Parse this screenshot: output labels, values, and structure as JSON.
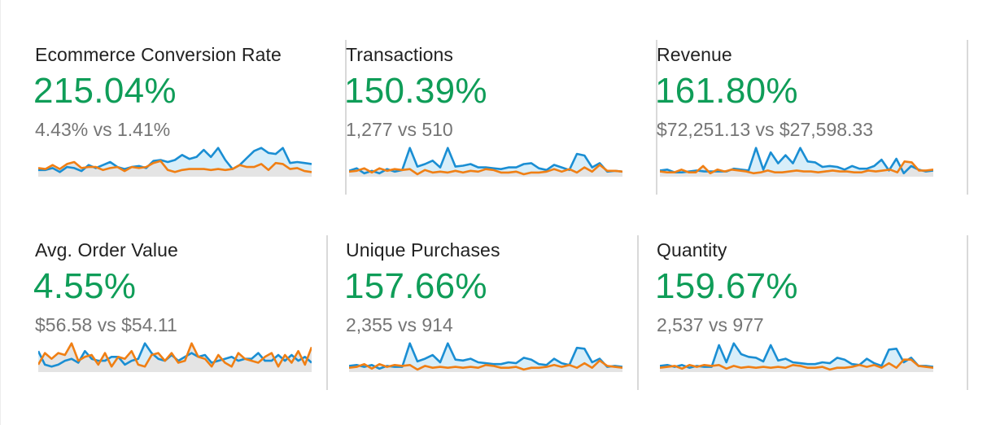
{
  "colors": {
    "percent_text": "#0f9d58",
    "current_series": "#1a8ed3",
    "previous_series": "#f07f14",
    "current_fill": "#d8eef9",
    "previous_fill": "#e4e4e4",
    "divider": "#d9d9d9"
  },
  "metrics": [
    {
      "title": "Ecommerce Conversion Rate",
      "percent_change": "215.04%",
      "comparison": "4.43% vs 1.41%",
      "spark_current": [
        5,
        5,
        7,
        3,
        8,
        7,
        4,
        10,
        7,
        10,
        13,
        8,
        6,
        8,
        9,
        7,
        14,
        15,
        13,
        15,
        20,
        16,
        18,
        25,
        18,
        27,
        15,
        6,
        10,
        17,
        24,
        27,
        22,
        21,
        27,
        12,
        13,
        12,
        11
      ],
      "spark_previous": [
        7,
        6,
        10,
        6,
        11,
        13,
        7,
        8,
        8,
        5,
        7,
        8,
        4,
        8,
        7,
        8,
        12,
        14,
        5,
        3,
        5,
        6,
        6,
        6,
        5,
        6,
        5,
        6,
        10,
        8,
        8,
        11,
        5,
        12,
        11,
        6,
        7,
        4,
        3
      ]
    },
    {
      "title": "Transactions",
      "percent_change": "150.39%",
      "comparison": "1,277 vs 510",
      "spark_current": [
        5,
        8,
        2,
        5,
        2,
        7,
        4,
        6,
        32,
        10,
        13,
        17,
        9,
        32,
        10,
        11,
        13,
        9,
        9,
        8,
        7,
        9,
        9,
        13,
        14,
        8,
        6,
        12,
        9,
        6,
        25,
        23,
        9,
        14,
        4,
        5,
        4
      ],
      "spark_previous": [
        4,
        5,
        8,
        3,
        8,
        5,
        7,
        6,
        7,
        1,
        6,
        3,
        4,
        3,
        5,
        3,
        5,
        4,
        7,
        6,
        3,
        3,
        4,
        1,
        3,
        3,
        4,
        7,
        4,
        7,
        3,
        9,
        4,
        12,
        5,
        5,
        4
      ]
    },
    {
      "title": "Revenue",
      "percent_change": "161.80%",
      "comparison": "$72,251.13 vs $27,598.33",
      "spark_current": [
        5,
        6,
        3,
        3,
        4,
        5,
        4,
        4,
        4,
        4,
        7,
        6,
        5,
        30,
        6,
        25,
        13,
        22,
        13,
        30,
        15,
        14,
        9,
        10,
        9,
        6,
        10,
        7,
        7,
        10,
        17,
        5,
        18,
        2,
        10,
        6,
        4,
        5
      ],
      "spark_previous": [
        4,
        3,
        3,
        6,
        3,
        3,
        10,
        2,
        6,
        4,
        6,
        5,
        4,
        2,
        3,
        5,
        3,
        3,
        4,
        5,
        4,
        4,
        3,
        4,
        5,
        4,
        4,
        3,
        3,
        5,
        4,
        5,
        6,
        3,
        15,
        14,
        5,
        5,
        6
      ]
    },
    {
      "title": "Avg. Order Value",
      "percent_change": "4.55%",
      "comparison": "$56.58 vs $54.11",
      "spark_current": [
        10,
        3,
        2,
        3,
        5,
        6,
        4,
        10,
        6,
        5,
        5,
        7,
        7,
        3,
        5,
        6,
        14,
        9,
        6,
        5,
        8,
        5,
        7,
        9,
        7,
        8,
        4,
        5,
        6,
        7,
        5,
        6,
        6,
        9,
        5,
        5,
        8,
        5,
        8,
        5,
        7,
        4
      ],
      "spark_previous": [
        3,
        9,
        6,
        9,
        8,
        14,
        5,
        7,
        8,
        3,
        9,
        2,
        7,
        6,
        10,
        3,
        2,
        8,
        9,
        5,
        9,
        4,
        5,
        14,
        7,
        6,
        2,
        8,
        4,
        2,
        9,
        6,
        5,
        4,
        7,
        9,
        2,
        8,
        4,
        10,
        3,
        12
      ]
    },
    {
      "title": "Unique Purchases",
      "percent_change": "157.66%",
      "comparison": "2,355 vs 914",
      "spark_current": [
        5,
        6,
        4,
        6,
        2,
        5,
        4,
        4,
        30,
        10,
        13,
        17,
        9,
        30,
        12,
        11,
        13,
        9,
        8,
        7,
        7,
        9,
        8,
        14,
        12,
        7,
        6,
        13,
        8,
        6,
        25,
        24,
        9,
        13,
        4,
        5,
        4
      ],
      "spark_previous": [
        3,
        4,
        7,
        2,
        7,
        4,
        6,
        5,
        6,
        1,
        5,
        3,
        4,
        3,
        4,
        3,
        4,
        3,
        6,
        5,
        3,
        3,
        4,
        1,
        3,
        3,
        4,
        6,
        4,
        6,
        3,
        8,
        3,
        11,
        5,
        4,
        3
      ]
    },
    {
      "title": "Quantity",
      "percent_change": "159.67%",
      "comparison": "2,537 vs 977",
      "spark_current": [
        5,
        6,
        4,
        6,
        3,
        5,
        4,
        4,
        28,
        9,
        30,
        18,
        15,
        14,
        10,
        28,
        11,
        13,
        9,
        8,
        7,
        7,
        9,
        8,
        14,
        12,
        7,
        6,
        13,
        8,
        5,
        23,
        24,
        9,
        14,
        5,
        5,
        4
      ],
      "spark_previous": [
        3,
        4,
        5,
        2,
        6,
        4,
        6,
        5,
        6,
        2,
        5,
        3,
        4,
        3,
        4,
        3,
        4,
        3,
        6,
        5,
        3,
        3,
        4,
        1,
        3,
        3,
        4,
        6,
        4,
        6,
        3,
        8,
        3,
        12,
        12,
        5,
        4,
        3
      ]
    }
  ]
}
